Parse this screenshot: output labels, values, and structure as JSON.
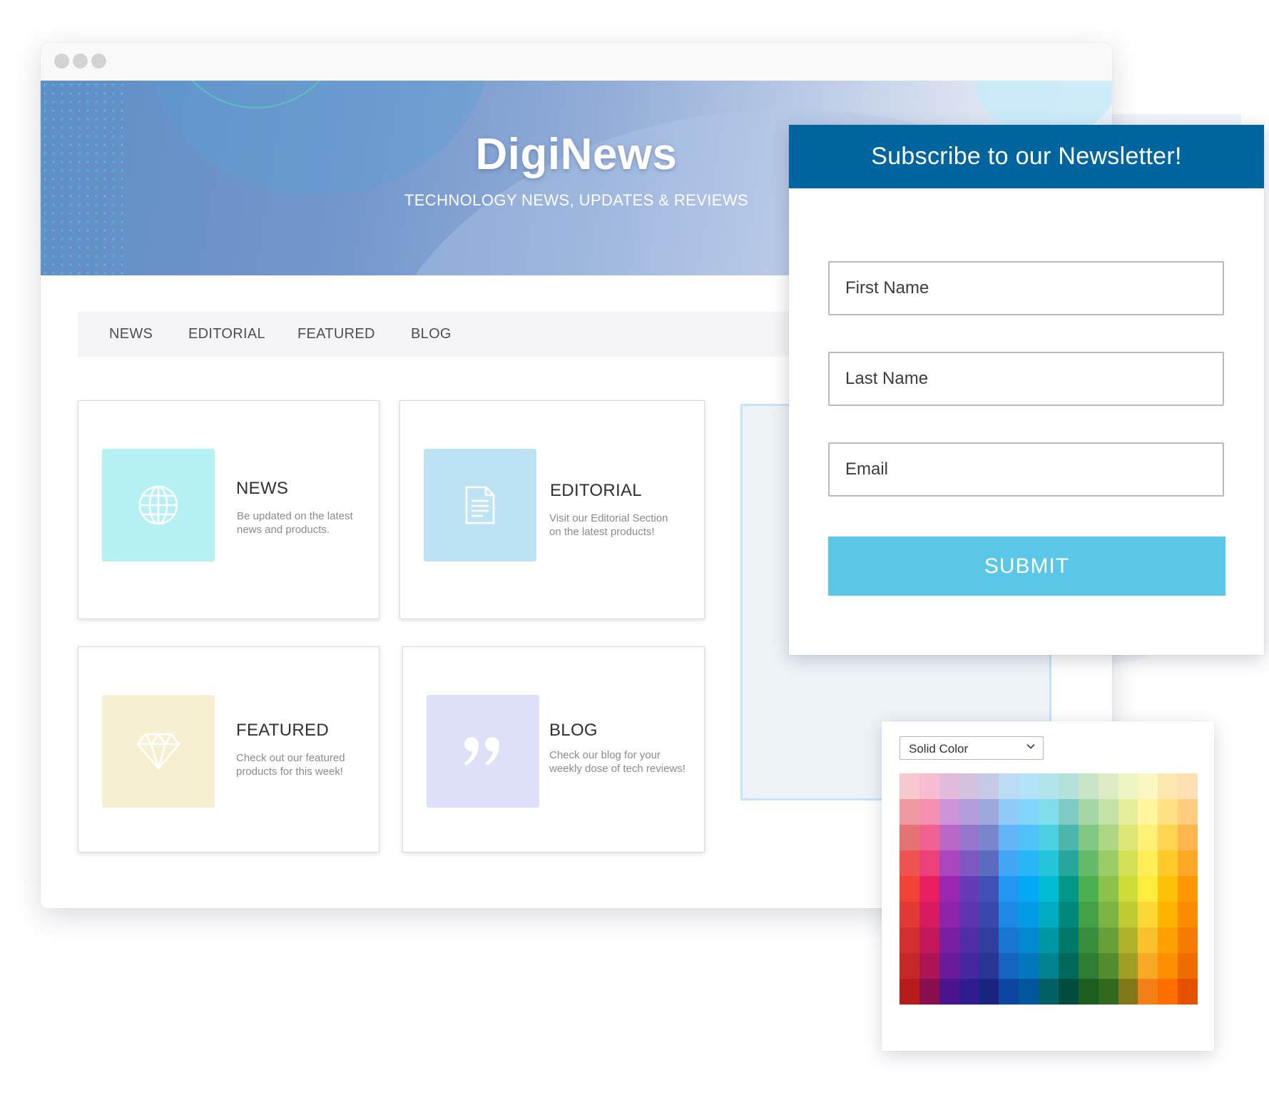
{
  "browser": {
    "hero": {
      "title": "DigiNews",
      "subtitle": "TECHNOLOGY NEWS, UPDATES & REVIEWS"
    },
    "nav": [
      {
        "label": "NEWS"
      },
      {
        "label": "EDITORIAL"
      },
      {
        "label": "FEATURED"
      },
      {
        "label": "BLOG"
      }
    ],
    "cards": [
      {
        "title": "NEWS",
        "desc_line1": "Be updated on the latest",
        "desc_line2": "news and products.",
        "icon": "globe-icon",
        "color": "#b5f0f3"
      },
      {
        "title": "EDITORIAL",
        "desc_line1": "Visit our Editorial Section",
        "desc_line2": "on the latest products!",
        "icon": "document-icon",
        "color": "#bde3f4"
      },
      {
        "title": "FEATURED",
        "desc_line1": "Check out our featured",
        "desc_line2": "products for this week!",
        "icon": "diamond-icon",
        "color": "#f7f0d0"
      },
      {
        "title": "BLOG",
        "desc_line1": "Check our blog for your",
        "desc_line2": "weekly dose of tech reviews!",
        "icon": "quote-icon",
        "color": "#dedff9"
      }
    ]
  },
  "newsletter": {
    "title": "Subscribe to our Newsletter!",
    "fields": {
      "first_name_placeholder": "First Name",
      "last_name_placeholder": "Last Name",
      "email_placeholder": "Email"
    },
    "submit_label": "SUBMIT",
    "header_color": "#00659f",
    "button_color": "#5ac7e9"
  },
  "color_picker": {
    "mode": "Solid Color",
    "swatches": [
      [
        "#f8c8d0",
        "#f6bdd2",
        "#e1bbda",
        "#d4c1de",
        "#c5c9e5",
        "#bcdcf5",
        "#b3e3f9",
        "#b2e4ed",
        "#b3e0d8",
        "#c8e5c8",
        "#ddecc6",
        "#eff5c2",
        "#fcf6c1",
        "#fde7b0",
        "#fde0b4"
      ],
      [
        "#ef9aa0",
        "#f48fb1",
        "#ce93d8",
        "#b39ddb",
        "#9fa8da",
        "#90caf9",
        "#81d4fa",
        "#80deea",
        "#80cbc4",
        "#a5d6a7",
        "#c5e1a5",
        "#e6ee9c",
        "#fff59d",
        "#ffe082",
        "#ffcc80"
      ],
      [
        "#e57373",
        "#f06292",
        "#ba68c8",
        "#9575cd",
        "#7986cb",
        "#64b5f6",
        "#4fc3f7",
        "#4dd0e1",
        "#4db6ac",
        "#81c784",
        "#aed581",
        "#dce775",
        "#fff176",
        "#ffd54f",
        "#ffb74d"
      ],
      [
        "#ef5350",
        "#ec407a",
        "#ab47bc",
        "#7e57c2",
        "#5c6bc0",
        "#42a5f5",
        "#29b6f6",
        "#26c6da",
        "#26a69a",
        "#66bb6a",
        "#9ccc65",
        "#d4e157",
        "#ffee58",
        "#ffca28",
        "#ffa726"
      ],
      [
        "#f44336",
        "#e91e63",
        "#9c27b0",
        "#673ab7",
        "#3f51b5",
        "#2196f3",
        "#03a9f4",
        "#00bcd4",
        "#009688",
        "#4caf50",
        "#8bc34a",
        "#cddc39",
        "#ffeb3b",
        "#ffc107",
        "#ff9800"
      ],
      [
        "#e53935",
        "#d81b60",
        "#8e24aa",
        "#5e35b1",
        "#3949ab",
        "#1e88e5",
        "#039be5",
        "#00acc1",
        "#00897b",
        "#43a047",
        "#7cb342",
        "#c0ca33",
        "#fdd835",
        "#ffb300",
        "#fb8c00"
      ],
      [
        "#d32f2f",
        "#c2185b",
        "#7b1fa2",
        "#512da8",
        "#303f9f",
        "#1976d2",
        "#0288d1",
        "#0097a7",
        "#00796b",
        "#388e3c",
        "#689f38",
        "#afb42b",
        "#fbc02d",
        "#ffa000",
        "#f57c00"
      ],
      [
        "#c62828",
        "#ad1457",
        "#6a1b9a",
        "#4527a0",
        "#283593",
        "#1565c0",
        "#0277bd",
        "#00838f",
        "#00695c",
        "#2e7d32",
        "#558b2f",
        "#9e9d24",
        "#f9a825",
        "#ff8f00",
        "#ef6c00"
      ],
      [
        "#b71c1c",
        "#880e4f",
        "#4a148c",
        "#311b92",
        "#1a237e",
        "#0d47a1",
        "#01579b",
        "#006064",
        "#004d40",
        "#1b5e20",
        "#33691e",
        "#827717",
        "#f57f17",
        "#ff6f00",
        "#e65100"
      ]
    ]
  }
}
